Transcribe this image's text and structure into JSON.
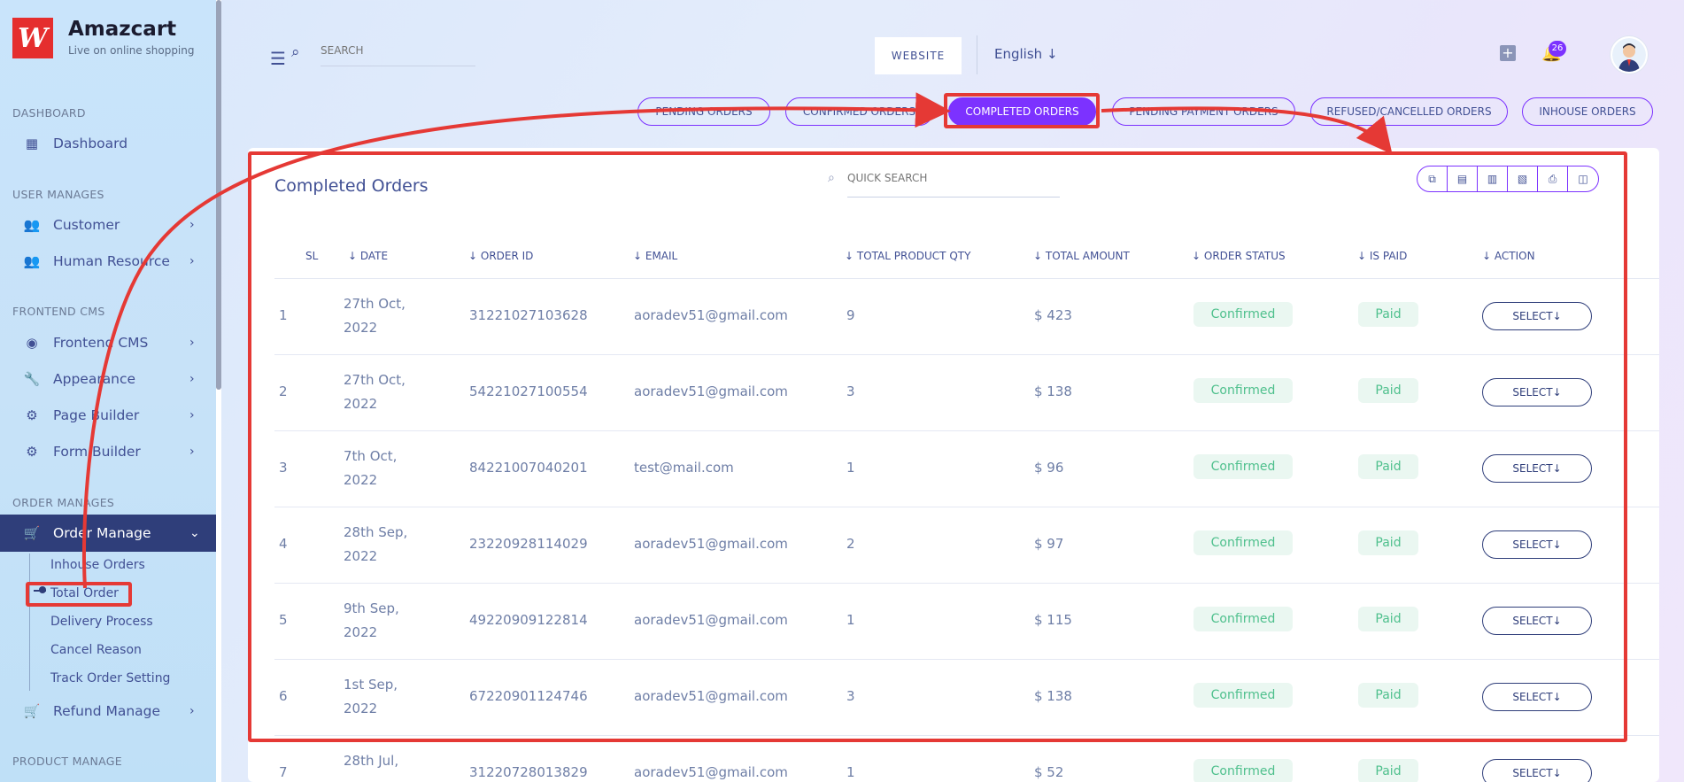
{
  "app": {
    "name": "Amazcart",
    "tagline": "Live on online shopping",
    "logo_glyph": "W"
  },
  "sidebar": {
    "sections": [
      {
        "label": "DASHBOARD"
      },
      {
        "label": "USER MANAGES"
      },
      {
        "label": "FRONTEND CMS"
      },
      {
        "label": "ORDER MANAGES"
      },
      {
        "label": "PRODUCT MANAGE"
      }
    ],
    "items": [
      {
        "label": "Dashboard",
        "icon": "grid-icon"
      },
      {
        "label": "Customer",
        "icon": "users-icon"
      },
      {
        "label": "Human Resource",
        "icon": "users-icon"
      },
      {
        "label": "Frontend CMS",
        "icon": "eye-icon"
      },
      {
        "label": "Appearance",
        "icon": "wrench-icon"
      },
      {
        "label": "Page Builder",
        "icon": "gears-icon"
      },
      {
        "label": "Form Builder",
        "icon": "gears-icon"
      },
      {
        "label": "Order Manage",
        "icon": "cart-icon",
        "active": true
      },
      {
        "label": "Refund Manage",
        "icon": "cart-icon"
      }
    ],
    "order_sub": [
      "Inhouse Orders",
      "Total Order",
      "Delivery Process",
      "Cancel Reason",
      "Track Order Setting"
    ]
  },
  "header": {
    "search_placeholder": "SEARCH",
    "website_label": "WEBSITE",
    "language": "English",
    "notification_count": "26"
  },
  "tabs": [
    {
      "label": "PENDING ORDERS"
    },
    {
      "label": "CONFIRMED ORDERS"
    },
    {
      "label": "COMPLETED ORDERS",
      "active": true
    },
    {
      "label": "PENDING PAYMENT ORDERS"
    },
    {
      "label": "REFUSED/CANCELLED ORDERS"
    },
    {
      "label": "INHOUSE ORDERS"
    }
  ],
  "card": {
    "title": "Completed Orders",
    "quick_search_placeholder": "QUICK SEARCH",
    "tools": [
      "copy-icon",
      "excel-icon",
      "csv-icon",
      "pdf-icon",
      "print-icon",
      "columns-icon"
    ],
    "columns": [
      "SL",
      "DATE",
      "ORDER ID",
      "EMAIL",
      "TOTAL PRODUCT QTY",
      "TOTAL AMOUNT",
      "ORDER STATUS",
      "IS PAID",
      "ACTION"
    ],
    "rows": [
      {
        "sl": "1",
        "date1": "27th Oct,",
        "date2": "2022",
        "order_id": "31221027103628",
        "email": "aoradev51@gmail.com",
        "qty": "9",
        "amount": "$ 423",
        "status": "Confirmed",
        "paid": "Paid",
        "action": "SELECT"
      },
      {
        "sl": "2",
        "date1": "27th Oct,",
        "date2": "2022",
        "order_id": "54221027100554",
        "email": "aoradev51@gmail.com",
        "qty": "3",
        "amount": "$ 138",
        "status": "Confirmed",
        "paid": "Paid",
        "action": "SELECT"
      },
      {
        "sl": "3",
        "date1": "7th Oct,",
        "date2": "2022",
        "order_id": "84221007040201",
        "email": "test@mail.com",
        "qty": "1",
        "amount": "$ 96",
        "status": "Confirmed",
        "paid": "Paid",
        "action": "SELECT"
      },
      {
        "sl": "4",
        "date1": "28th Sep,",
        "date2": "2022",
        "order_id": "23220928114029",
        "email": "aoradev51@gmail.com",
        "qty": "2",
        "amount": "$ 97",
        "status": "Confirmed",
        "paid": "Paid",
        "action": "SELECT"
      },
      {
        "sl": "5",
        "date1": "9th Sep,",
        "date2": "2022",
        "order_id": "49220909122814",
        "email": "aoradev51@gmail.com",
        "qty": "1",
        "amount": "$ 115",
        "status": "Confirmed",
        "paid": "Paid",
        "action": "SELECT"
      },
      {
        "sl": "6",
        "date1": "1st Sep,",
        "date2": "2022",
        "order_id": "67220901124746",
        "email": "aoradev51@gmail.com",
        "qty": "3",
        "amount": "$ 138",
        "status": "Confirmed",
        "paid": "Paid",
        "action": "SELECT"
      },
      {
        "sl": "7",
        "date1": "28th Jul,",
        "date2": "",
        "order_id": "31220728013829",
        "email": "aoradev51@gmail.com",
        "qty": "1",
        "amount": "$ 52",
        "status": "Confirmed",
        "paid": "Paid",
        "action": "SELECT"
      }
    ]
  },
  "colors": {
    "accent": "#7c32ff",
    "annotation": "#e53935",
    "sidebar_active": "#2f3e7a",
    "success": "#4fc08d"
  }
}
